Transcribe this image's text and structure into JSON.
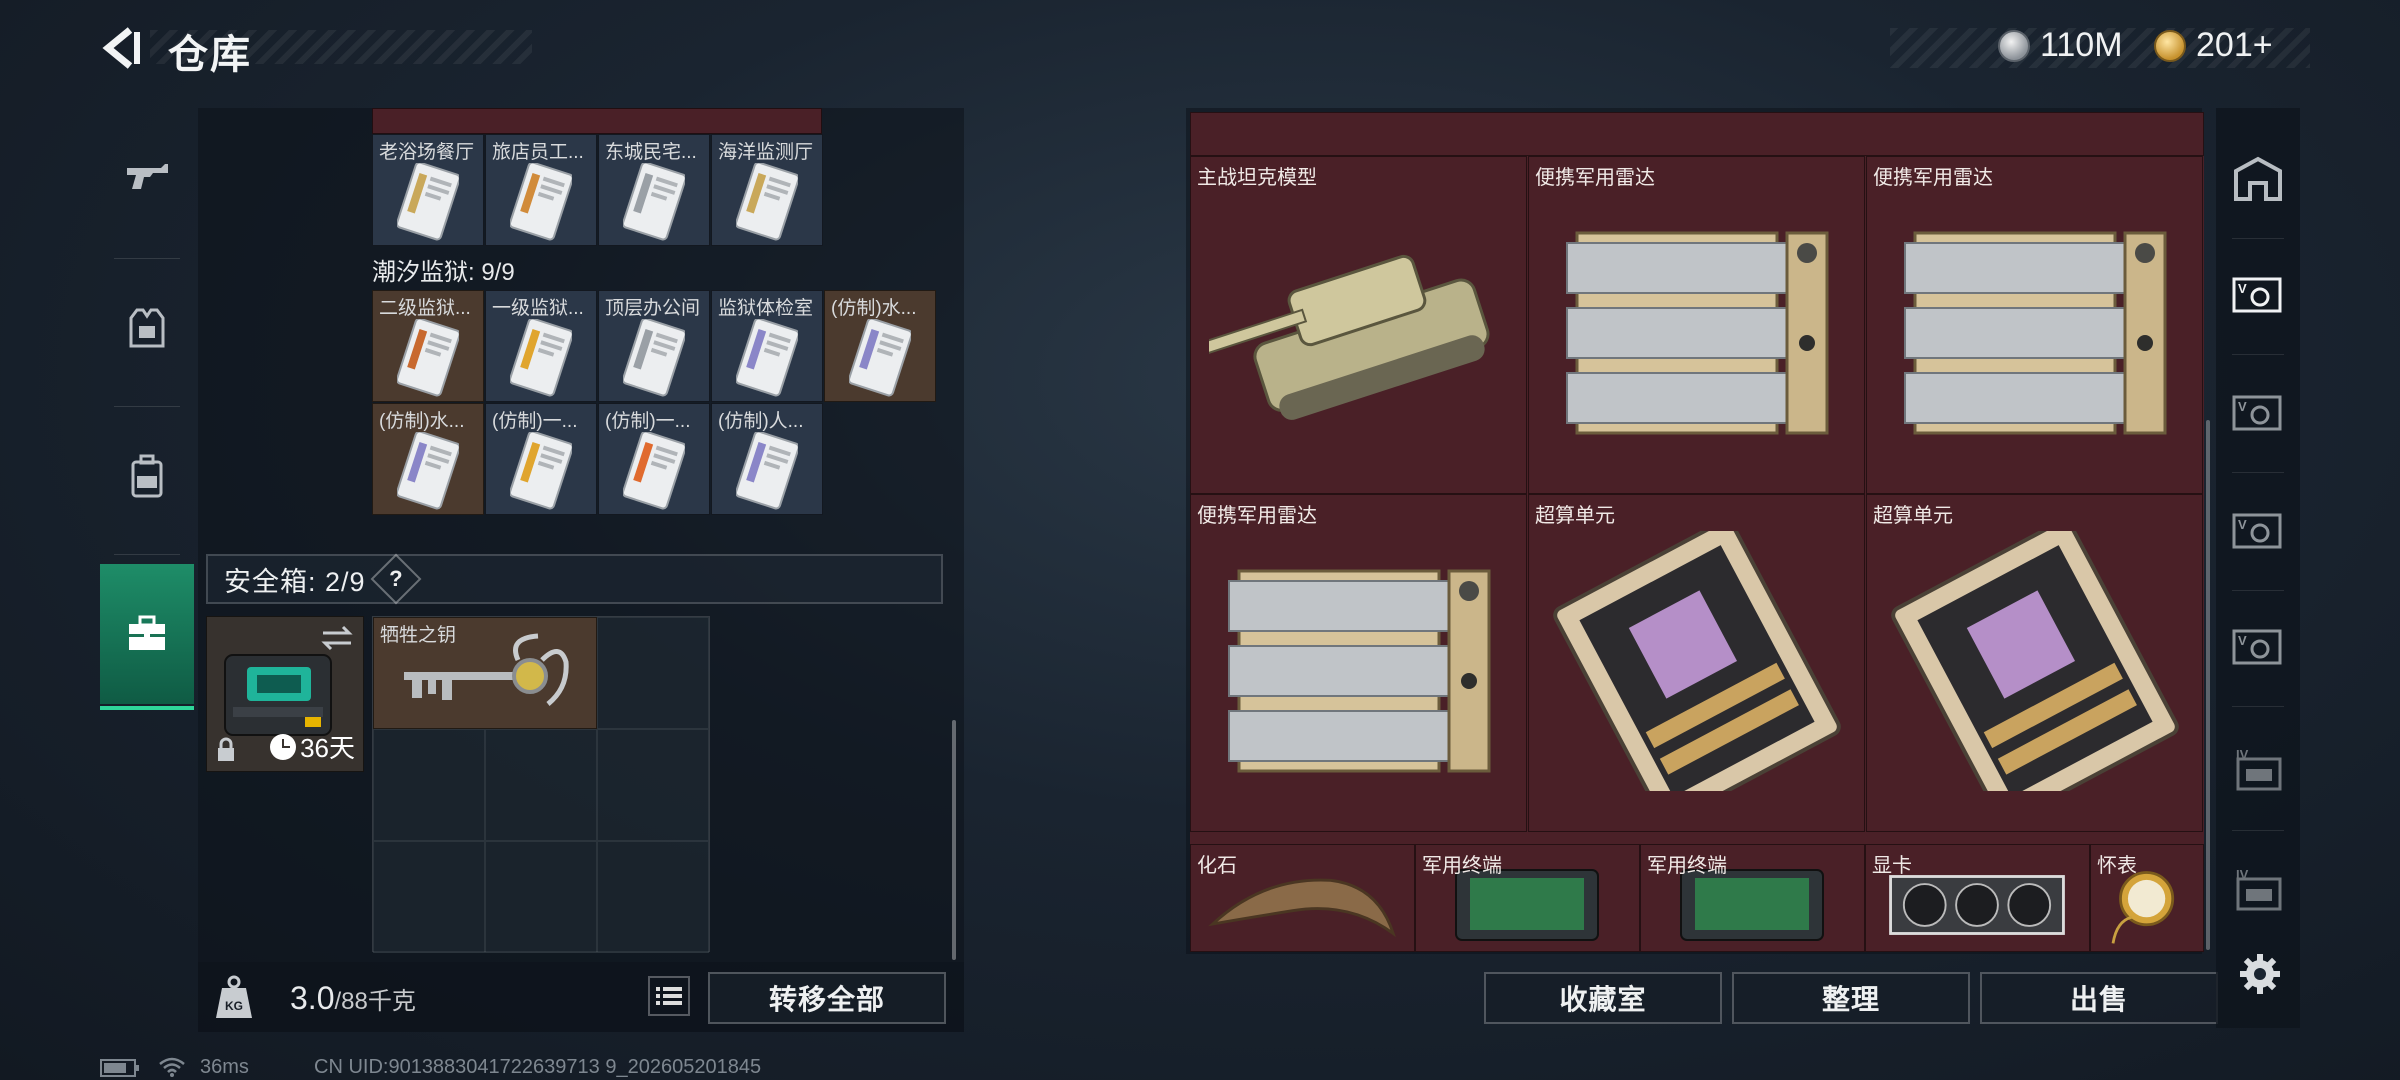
{
  "header": {
    "title": "仓库",
    "currencies": [
      {
        "icon": "silver-coin-icon",
        "value": "110M"
      },
      {
        "icon": "gold-coin-icon",
        "value": "201+"
      }
    ]
  },
  "left_nav": [
    {
      "icon": "gun-icon",
      "active": false
    },
    {
      "icon": "armor-vest-icon",
      "active": false
    },
    {
      "icon": "backpack-icon",
      "active": false
    },
    {
      "icon": "briefcase-icon",
      "active": true
    }
  ],
  "keycards_top": [
    "老浴场餐厅",
    "旅店员工...",
    "东城民宅...",
    "海洋监测厅"
  ],
  "prison_section": {
    "label": "潮汐监狱: 9/9",
    "row1": [
      "二级监狱...",
      "一级监狱...",
      "顶层办公间",
      "监狱体检室",
      "(仿制)水..."
    ],
    "row2": [
      "(仿制)水...",
      "(仿制)一...",
      "(仿制)一...",
      "(仿制)人..."
    ]
  },
  "safe": {
    "label": "安全箱: 2/9",
    "help": "?",
    "days": "36天",
    "items": [
      {
        "label": "牺牲之钥"
      }
    ]
  },
  "weight": {
    "current": "3.0",
    "max": "/88千克"
  },
  "transfer_all": "转移全部",
  "stash": {
    "big_items": [
      {
        "label": "主战坦克模型",
        "kind": "tank"
      },
      {
        "label": "便携军用雷达",
        "kind": "radar"
      },
      {
        "label": "便携军用雷达",
        "kind": "radar"
      },
      {
        "label": "便携军用雷达",
        "kind": "radar"
      },
      {
        "label": "超算单元",
        "kind": "board"
      },
      {
        "label": "超算单元",
        "kind": "board"
      }
    ],
    "small_items": [
      {
        "label": "化石",
        "kind": "fossil"
      },
      {
        "label": "军用终端",
        "kind": "terminal"
      },
      {
        "label": "军用终端",
        "kind": "terminal"
      },
      {
        "label": "显卡",
        "kind": "gpu"
      },
      {
        "label": "怀表",
        "kind": "watch"
      }
    ]
  },
  "bottom_buttons": {
    "collection": "收藏室",
    "organize": "整理",
    "sell": "出售"
  },
  "right_tabs": [
    "tower-icon",
    "keycard-lv-icon",
    "keycard-lv-icon",
    "keycard-lv-icon",
    "keycard-lv-icon",
    "keycard-lv4-icon",
    "keycard-lv4-icon"
  ],
  "status": {
    "ping": "36ms",
    "uid": "CN UID:9013883041722639713 9_202605201845"
  }
}
